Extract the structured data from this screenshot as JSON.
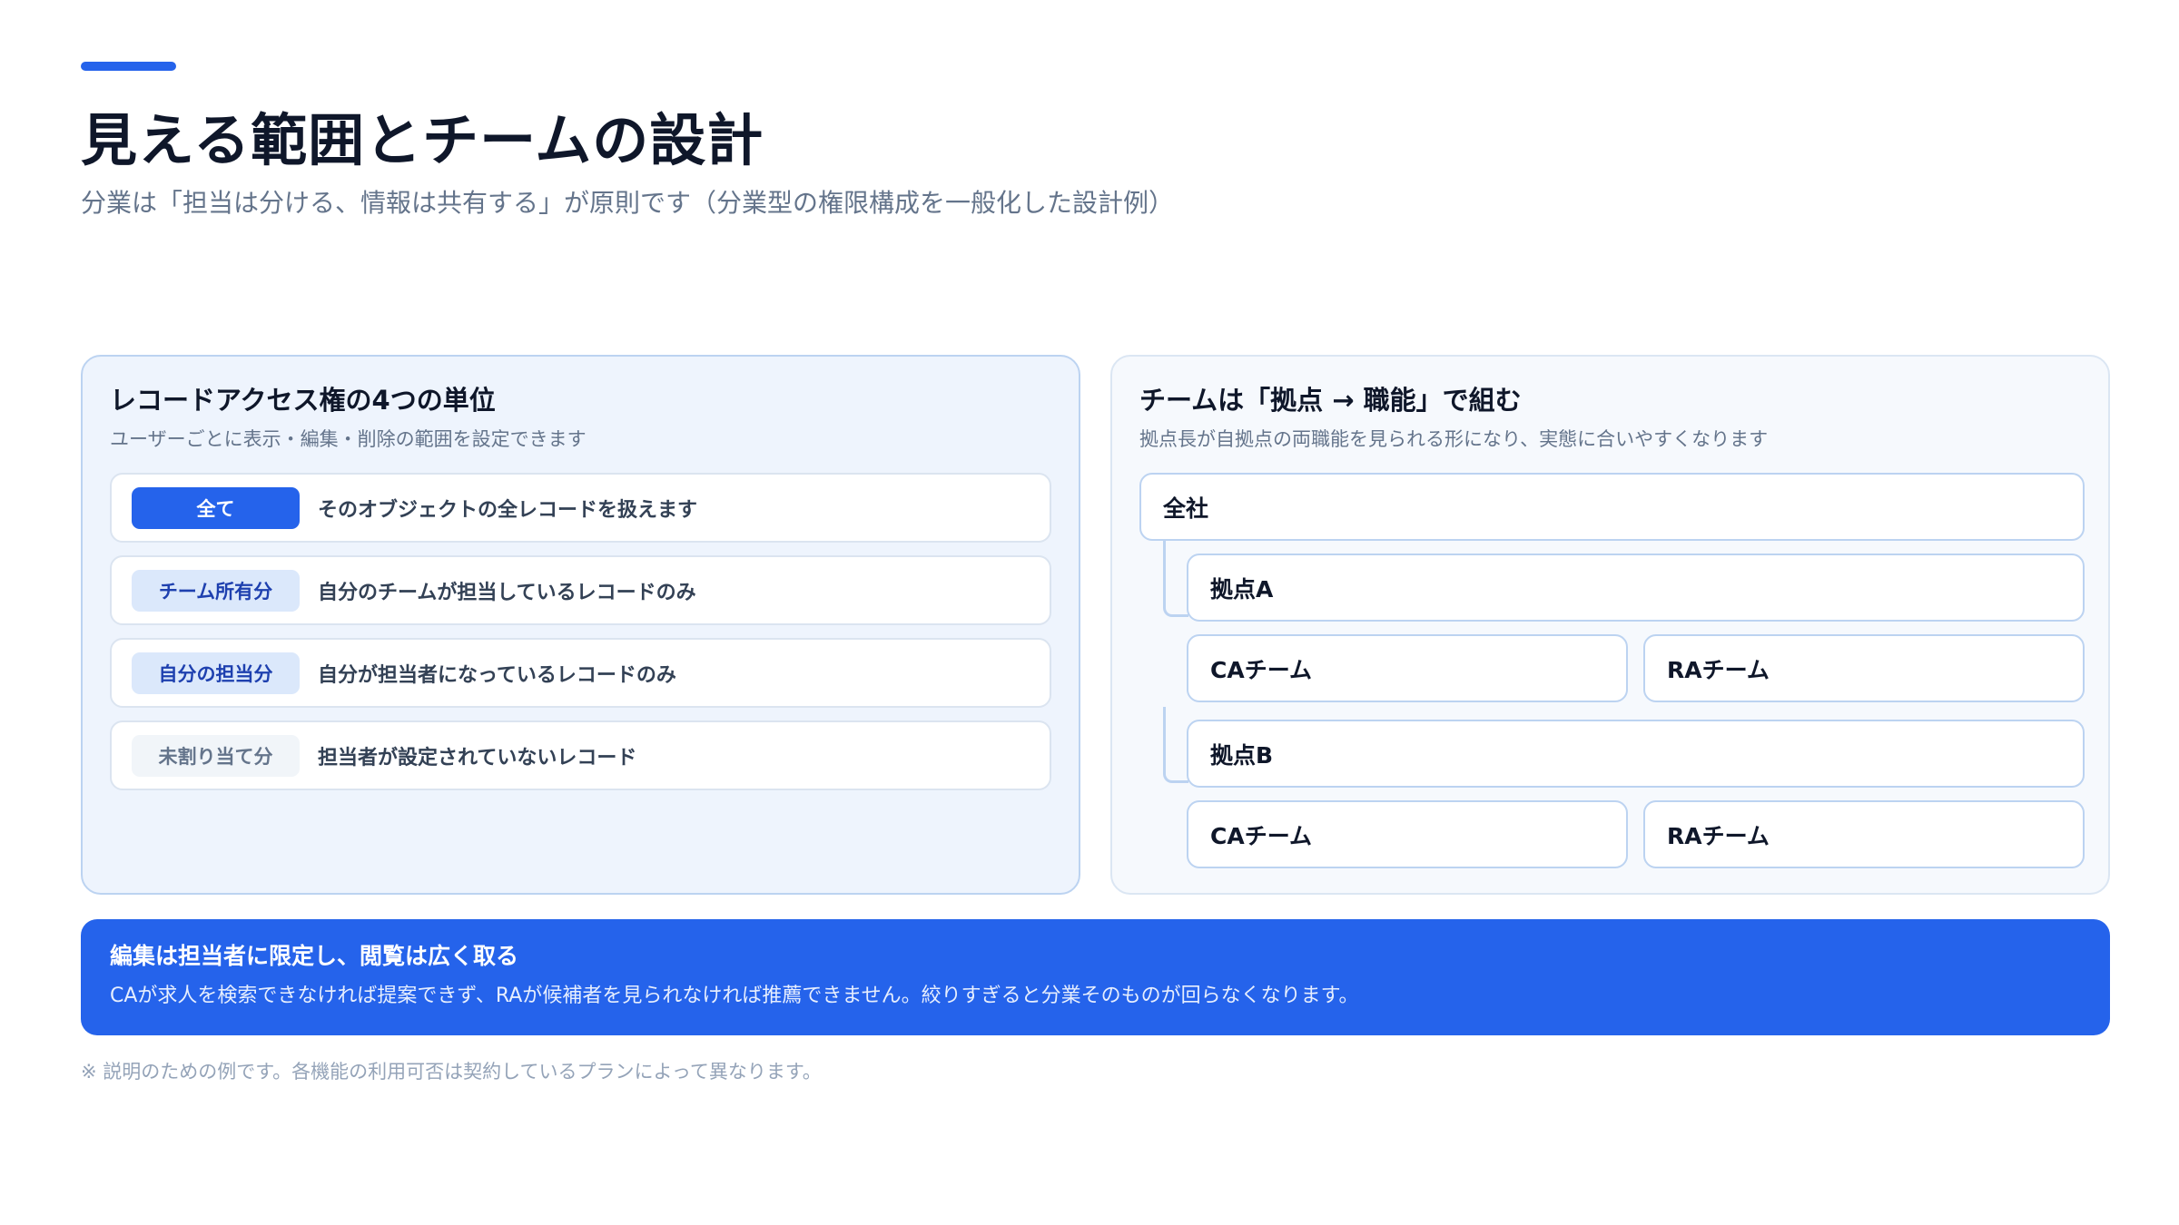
{
  "header": {
    "title": "見える範囲とチームの設計",
    "subtitle": "分業は「担当は分ける、情報は共有する」が原則です（分業型の権限構成を一般化した設計例）"
  },
  "access_panel": {
    "title": "レコードアクセス権の4つの単位",
    "subtitle": "ユーザーごとに表示・編集・削除の範囲を設定できます",
    "rows": [
      {
        "badge": "全て",
        "description": "そのオブジェクトの全レコードを扱えます"
      },
      {
        "badge": "チーム所有分",
        "description": "自分のチームが担当しているレコードのみ"
      },
      {
        "badge": "自分の担当分",
        "description": "自分が担当者になっているレコードのみ"
      },
      {
        "badge": "未割り当て分",
        "description": "担当者が設定されていないレコード"
      }
    ]
  },
  "team_panel": {
    "title": "チームは「拠点 → 職能」で組む",
    "subtitle": "拠点長が自拠点の両職能を見られる形になり、実態に合いやすくなります",
    "root": "全社",
    "sites": [
      {
        "name": "拠点A",
        "teams": [
          "CAチーム",
          "RAチーム"
        ]
      },
      {
        "name": "拠点B",
        "teams": [
          "CAチーム",
          "RAチーム"
        ]
      }
    ]
  },
  "callout": {
    "title": "編集は担当者に限定し、閲覧は広く取る",
    "body": "CAが求人を検索できなければ提案できず、RAが候補者を見られなければ推薦できません。絞りすぎると分業そのものが回らなくなります。"
  },
  "footnote": "※ 説明のための例です。各機能の利用可否は契約しているプランによって異なります。",
  "colors": {
    "accent": "#2563eb",
    "text": "#0f172a",
    "muted": "#64748b"
  }
}
